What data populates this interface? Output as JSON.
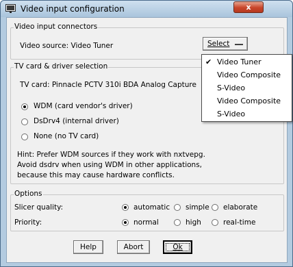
{
  "window": {
    "title": "Video input configuration",
    "close_glyph": "x"
  },
  "connectors": {
    "legend": "Video input connectors",
    "video_source_label": "Video source: Video Tuner",
    "select_label": "Select"
  },
  "tvcard": {
    "legend": "TV card & driver selection",
    "card_label": "TV card: Pinnacle PCTV 310i BDA Analog Capture",
    "drivers": [
      {
        "label": "WDM (card vendor's driver)",
        "selected": true
      },
      {
        "label": "DsDrv4 (internal driver)",
        "selected": false
      },
      {
        "label": "None (no TV card)",
        "selected": false
      }
    ],
    "hint_lines": [
      "Hint: Prefer WDM sources if they work with nxtvepg.",
      "Avoid dsdrv when using WDM in other applications,",
      "because this may cause hardware conflicts."
    ]
  },
  "options": {
    "legend": "Options",
    "slicer_label": "Slicer quality:",
    "slicer_choices": [
      {
        "label": "automatic",
        "selected": true
      },
      {
        "label": "simple",
        "selected": false
      },
      {
        "label": "elaborate",
        "selected": false
      }
    ],
    "priority_label": "Priority:",
    "priority_choices": [
      {
        "label": "normal",
        "selected": true
      },
      {
        "label": "high",
        "selected": false
      },
      {
        "label": "real-time",
        "selected": false
      }
    ]
  },
  "buttons": {
    "help": "Help",
    "abort": "Abort",
    "ok": "Ok"
  },
  "dropdown": {
    "check_glyph": "✔",
    "items": [
      {
        "label": "Video Tuner",
        "checked": true
      },
      {
        "label": "Video Composite",
        "checked": false
      },
      {
        "label": "S-Video",
        "checked": false
      },
      {
        "label": "Video Composite",
        "checked": false
      },
      {
        "label": "S-Video",
        "checked": false
      }
    ]
  },
  "colors": {
    "window_frame": "#b3cbe0",
    "client_bg": "#f0f0f0",
    "close_button": "#c8452a"
  },
  "icons": {
    "app_icon": "monitor-icon",
    "check_icon": "check-icon"
  }
}
